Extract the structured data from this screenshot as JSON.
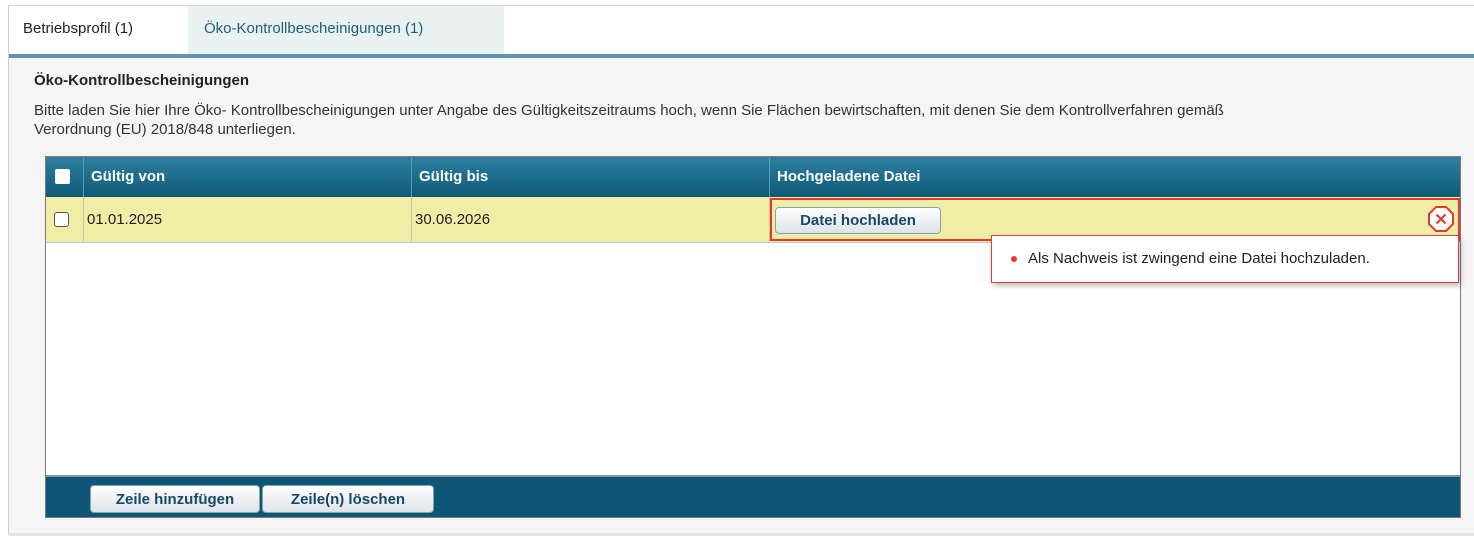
{
  "tabs": [
    {
      "label": "Betriebsprofil (1)"
    },
    {
      "label": "Öko-Kontrollbescheinigungen (1)"
    }
  ],
  "section": {
    "title": "Öko-Kontrollbescheinigungen",
    "description_line1": "Bitte laden Sie hier Ihre Öko- Kontrollbescheinigungen unter Angabe des Gültigkeitszeitraums hoch, wenn Sie Flächen bewirtschaften, mit denen Sie dem Kontrollverfahren gemäß",
    "description_line2": "Verordnung (EU) 2018/848 unterliegen."
  },
  "table": {
    "columns": [
      "Gültig von",
      "Gültig bis",
      "Hochgeladene Datei"
    ],
    "rows": [
      {
        "gueltig_von": "01.01.2025",
        "gueltig_bis": "30.06.2026",
        "upload_label": "Datei hochladen"
      }
    ],
    "error_message": "Als Nachweis ist zwingend eine Datei hochzuladen.",
    "footer": {
      "add_label": "Zeile hinzufügen",
      "delete_label": "Zeile(n) löschen"
    }
  },
  "colors": {
    "header": "#1b6b8c",
    "row_error": "#f0eea6",
    "error": "#e33b2e",
    "footer": "#0f5576"
  },
  "icons": {
    "error": "error-circle-x-icon"
  }
}
